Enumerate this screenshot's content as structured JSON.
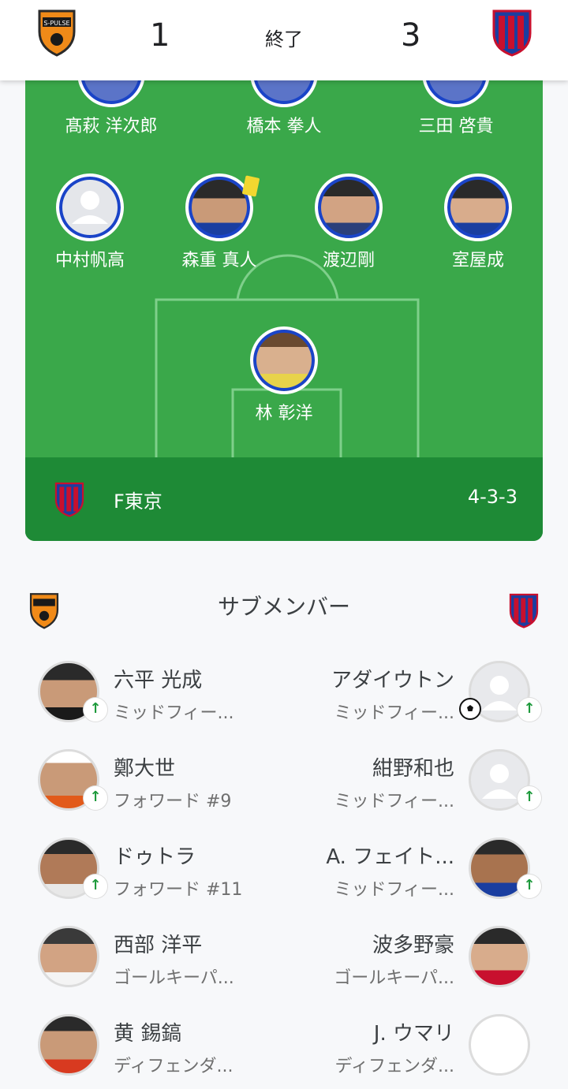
{
  "header": {
    "home_score": "1",
    "away_score": "3",
    "status": "終了",
    "home_crest_icon": "shimizu-s-pulse-crest",
    "away_crest_icon": "fc-tokyo-crest"
  },
  "pitch": {
    "team_name": "F東京",
    "formation": "4-3-3",
    "colors": {
      "pitch": "#3aa84a",
      "team_bar": "#1e8a36",
      "ring": "#1a44c8",
      "yellow_card": "#f2d730"
    },
    "players": [
      {
        "name": "髙萩 洋次郎"
      },
      {
        "name": "橋本 拳人"
      },
      {
        "name": "三田 啓貴"
      },
      {
        "name": "中村帆高"
      },
      {
        "name": "森重 真人",
        "yellow_card": true
      },
      {
        "name": "渡辺剛"
      },
      {
        "name": "室屋成"
      },
      {
        "name": "林 彰洋"
      }
    ]
  },
  "subs": {
    "title": "サブメンバー",
    "home": [
      {
        "name": "六平 光成",
        "role": "ミッドフィー...",
        "subbed_in": true
      },
      {
        "name": "鄭大世",
        "role": "フォワード #9",
        "subbed_in": true
      },
      {
        "name": "ドゥトラ",
        "role": "フォワード #11",
        "subbed_in": true
      },
      {
        "name": "西部 洋平",
        "role": "ゴールキーパ...",
        "subbed_in": false
      },
      {
        "name": "黄 錫鎬",
        "role": "ディフェンダ...",
        "subbed_in": false
      }
    ],
    "away": [
      {
        "name": "アダイウトン",
        "role": "ミッドフィー...",
        "subbed_in": true,
        "goal": true
      },
      {
        "name": "紺野和也",
        "role": "ミッドフィー...",
        "subbed_in": true
      },
      {
        "name": "A. フェイト...",
        "role": "ミッドフィー...",
        "subbed_in": true
      },
      {
        "name": "波多野豪",
        "role": "ゴールキーパ...",
        "subbed_in": false
      },
      {
        "name": "J. ウマリ",
        "role": "ディフェンダ...",
        "subbed_in": false
      }
    ]
  }
}
